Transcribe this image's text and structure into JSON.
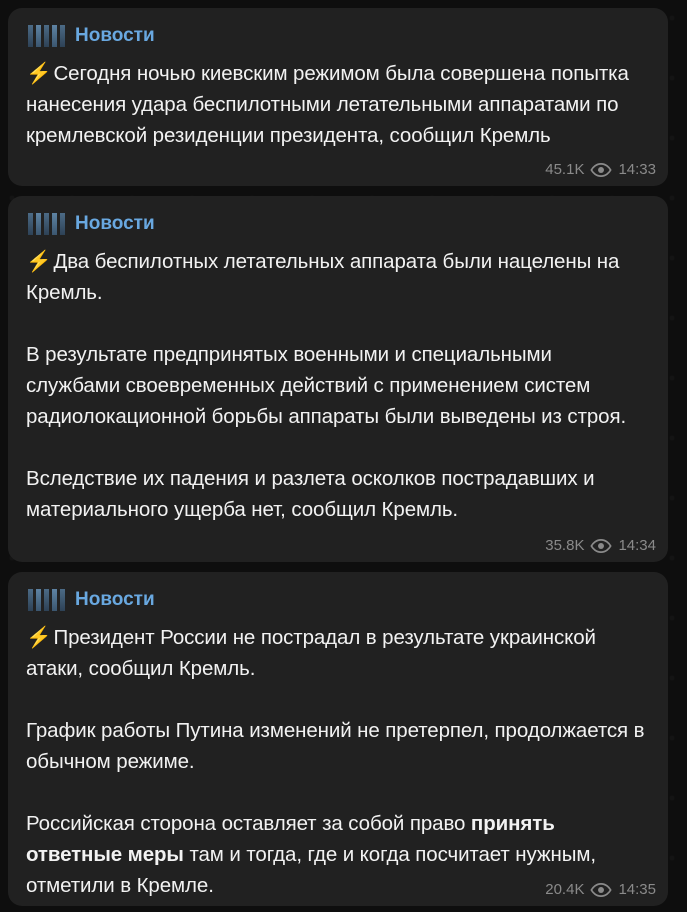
{
  "messages": [
    {
      "channel": "Новости",
      "bolt": "⚡",
      "paragraphs": [
        "Сегодня ночью киевским режимом была совершена попытка нанесения удара беспилотными летательными аппаратами по кремлевской резиденции президента, сообщил Кремль"
      ],
      "views": "45.1K",
      "time": "14:33"
    },
    {
      "channel": "Новости",
      "bolt": "⚡",
      "paragraphs": [
        "Два беспилотных летательных аппарата были нацелены на Кремль.",
        "В результате предпринятых военными и специальными службами своевременных действий с применением систем радиолокационной борьбы аппараты были выведены из строя.",
        "Вследствие их падения и разлета осколков пострадавших и материального ущерба нет, сообщил Кремль."
      ],
      "views": "35.8K",
      "time": "14:34"
    },
    {
      "channel": "Новости",
      "bolt": "⚡",
      "paragraphs": [
        "Президент России не пострадал в результате украинской атаки, сообщил Кремль.",
        "График работы Путина изменений не претерпел, продолжается в обычном режиме."
      ],
      "last_paragraph": {
        "before": "Российская сторона оставляет за собой право ",
        "bold": "принять ответные меры",
        "after": " там и тогда, где и когда посчитает нужным, отметили в Кремле."
      },
      "views": "20.4K",
      "time": "14:35"
    }
  ],
  "colors": {
    "background": "#0e0e0e",
    "bubble": "#212121",
    "channel": "#69a8e0",
    "text": "#f2f2f2",
    "meta": "#8a8a8a",
    "bolt": "#f6b53a"
  },
  "icons": {
    "channel_avatar": "bars-logo-icon",
    "views": "eye-icon",
    "bolt": "lightning-icon"
  }
}
